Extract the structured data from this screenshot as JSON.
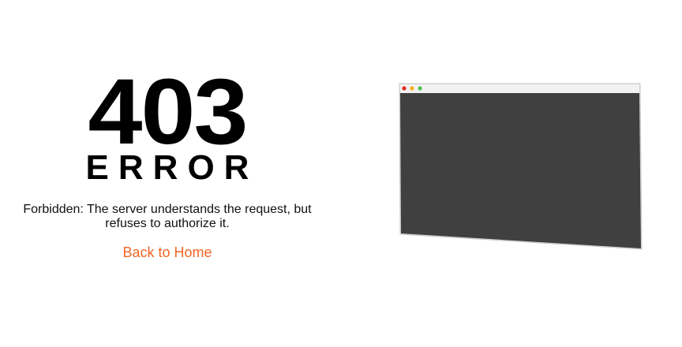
{
  "error": {
    "code": "403",
    "word": "ERROR",
    "message": "Forbidden: The server understands the request, but refuses to authorize it.",
    "link_label": "Back to Home",
    "link_color": "#f26522"
  },
  "illustration": {
    "icon": "browser-window-icon",
    "screen_color": "#404040",
    "titlebar_color": "#f2f2f2",
    "window_buttons": [
      {
        "name": "close",
        "color": "#e0281e"
      },
      {
        "name": "minimize",
        "color": "#f5b21a"
      },
      {
        "name": "maximize",
        "color": "#4cc24e"
      }
    ]
  }
}
